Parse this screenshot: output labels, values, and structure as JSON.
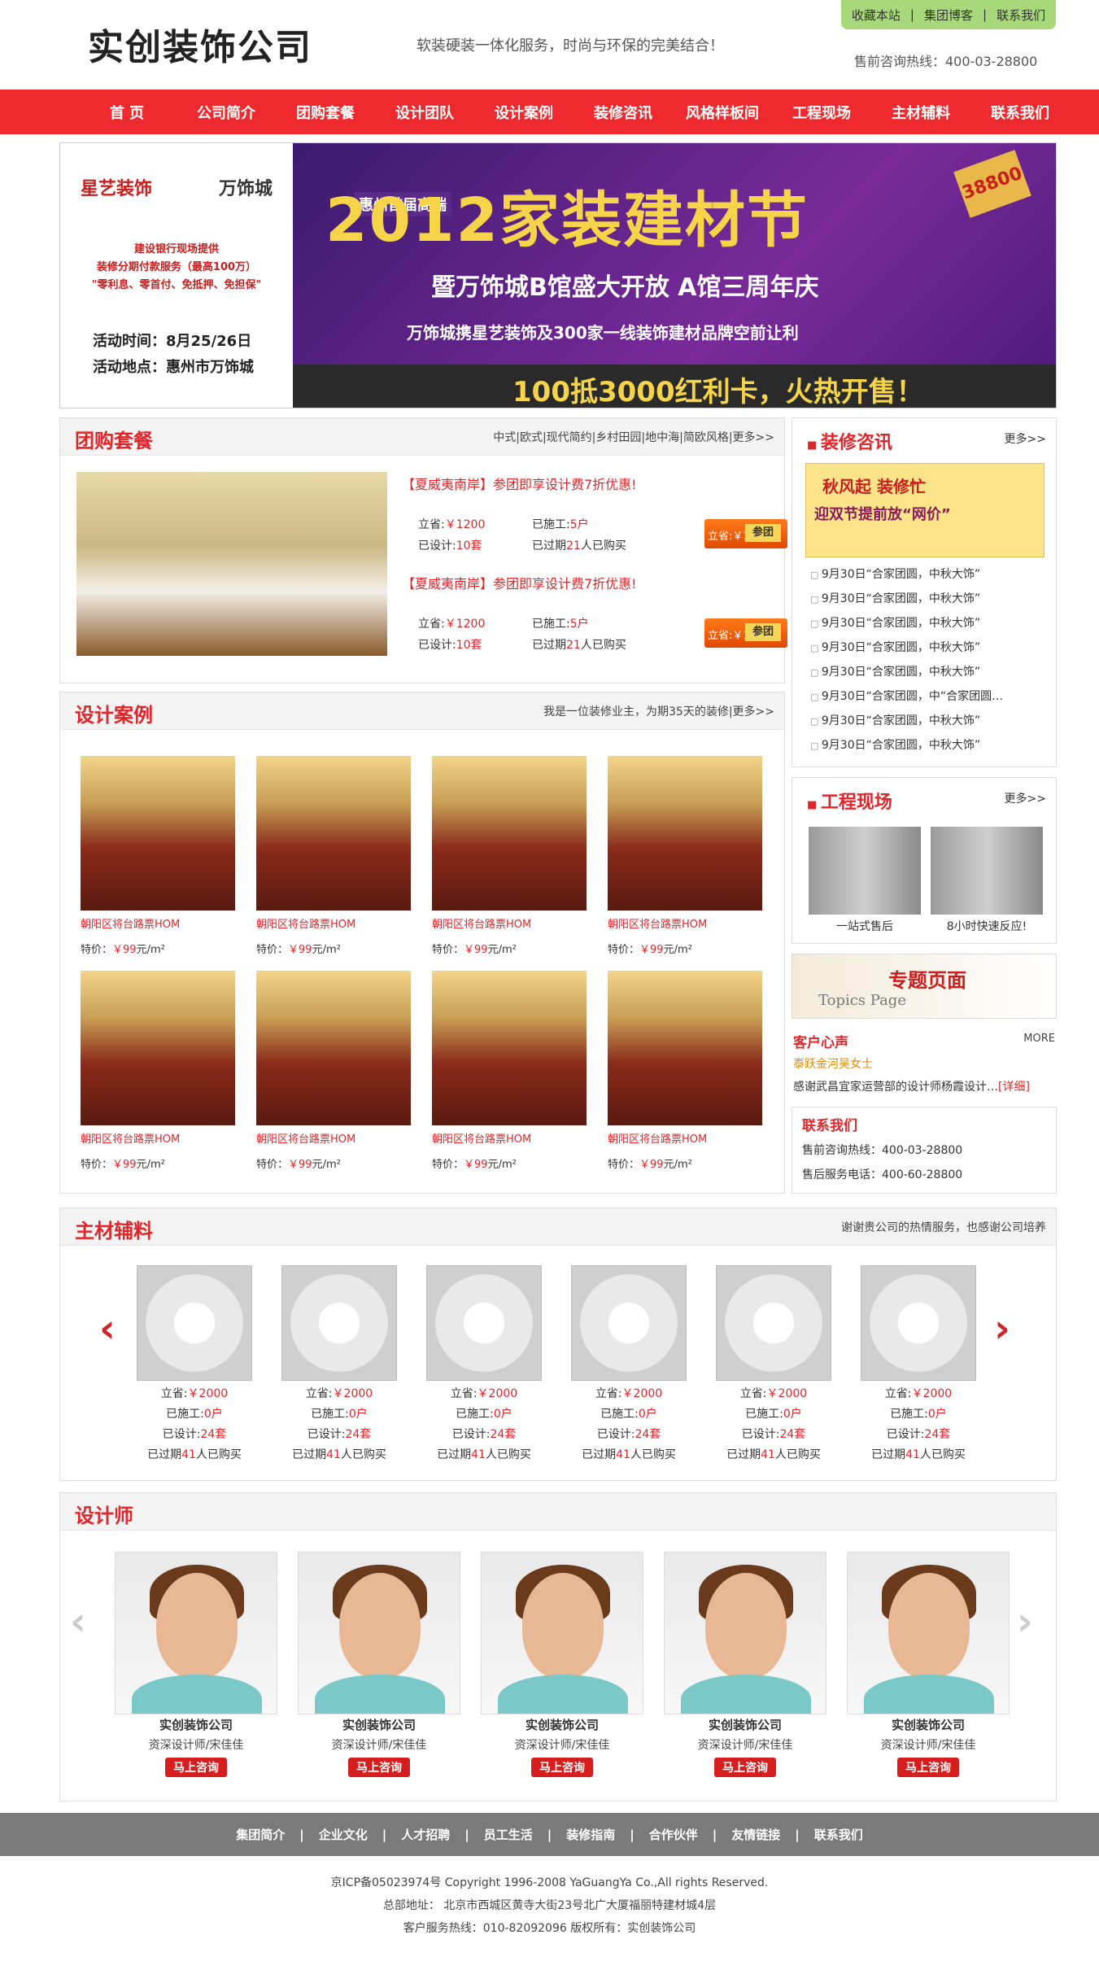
{
  "header": {
    "logo": "实创装饰公司",
    "slogan": "软装硬装一体化服务，时尚与环保的完美结合！",
    "toplinks": [
      "收藏本站",
      "集团博客",
      "联系我们"
    ],
    "hotline": "售前咨询热线：400-03-28800"
  },
  "nav": [
    "首 页",
    "公司简介",
    "团购套餐",
    "设计团队",
    "设计案例",
    "装修咨讯",
    "风格样板间",
    "工程现场",
    "主材辅料",
    "联系我们"
  ],
  "banner": {
    "brand": "星艺装饰",
    "brand2": "万饰城",
    "promo1": "建设银行现场提供",
    "promo2": "装修分期付款服务（最高100万）",
    "promo3": "\"零利息、零首付、免抵押、免担保\"",
    "date": "活动时间：8月25/26日",
    "place": "活动地点：惠州市万饰城",
    "headline": "2012家装建材节",
    "tag": "惠州首届高端",
    "sub": "暨万饰城B馆盛大开放 A馆三周年庆",
    "sub2": "万饰城携星艺装饰及300家一线装饰建材品牌空前让利",
    "bottom": "100抵3000红利卡，火热开售！",
    "corner": "38800"
  },
  "group": {
    "title": "团购套餐",
    "more": "中式|欧式|现代简约|乡村田园|地中海|简欧风格|更多>>",
    "items": [
      {
        "title": "【夏威夷南岸】参团即享设计费7折优惠!",
        "save_l": "立省:",
        "save": "￥1200",
        "work_l": "已施工:",
        "work": "5户",
        "design_l": "已设计:",
        "design": "10套",
        "past_a": "已过期",
        "past_n": "21",
        "past_b": "人已购买",
        "btn_price": "立省:￥1200",
        "btn": "参团"
      },
      {
        "title": "【夏威夷南岸】参团即享设计费7折优惠!",
        "save_l": "立省:",
        "save": "￥1200",
        "work_l": "已施工:",
        "work": "5户",
        "design_l": "已设计:",
        "design": "10套",
        "past_a": "已过期",
        "past_n": "21",
        "past_b": "人已购买",
        "btn_price": "立省:￥1200",
        "btn": "参团"
      }
    ]
  },
  "news": {
    "title": "装修咨讯",
    "more": "更多>>",
    "ad1": "秋风起 装修忙",
    "ad2": "迎双节提前放“网价”",
    "items": [
      "9月30日“合家团圆，中秋大饰”",
      "9月30日“合家团圆，中秋大饰”",
      "9月30日“合家团圆，中秋大饰”",
      "9月30日“合家团圆，中秋大饰”",
      "9月30日“合家团圆，中秋大饰”",
      "9月30日“合家团圆，中“合家团圆…",
      "9月30日“合家团圆，中秋大饰”",
      "9月30日“合家团圆，中秋大饰”"
    ]
  },
  "cases": {
    "title": "设计案例",
    "more": "我是一位装修业主，为期35天的装修|更多>>",
    "name": "朝阳区将台路票HOM",
    "price_l": "特价：",
    "price": "￥99",
    "price_u": "元/m²"
  },
  "site": {
    "title": "工程现场",
    "more": "更多>>",
    "items": [
      "一站式售后",
      "8小时快速反应!"
    ]
  },
  "topics": {
    "title": "专题页面",
    "en": "Topics Page"
  },
  "client": {
    "title": "客户心声",
    "more": "MORE",
    "name": "泰跃金河吴女士",
    "text": "感谢武昌宜家运营部的设计师杨霞设计…",
    "link": "[详细]"
  },
  "contact": {
    "title": "联系我们",
    "pre": "售前咨询热线：400-03-28800",
    "post": "售后服务电话：400-60-28800"
  },
  "materials": {
    "title": "主材辅料",
    "more": "谢谢贵公司的热情服务，也感谢公司培养",
    "save_l": "立省:",
    "save": "￥2000",
    "work_l": "已施工:",
    "work": "0户",
    "design_l": "已设计:",
    "design": "24套",
    "past_a": "已过期",
    "past_n": "41",
    "past_b": "人已购买"
  },
  "designers": {
    "title": "设计师",
    "company": "实创装饰公司",
    "role": "资深设计师/宋佳佳",
    "btn": "马上咨询"
  },
  "footer": {
    "links": [
      "集团简介",
      "企业文化",
      "人才招聘",
      "员工生活",
      "装修指南",
      "合作伙伴",
      "友情链接",
      "联系我们"
    ],
    "icp": "京ICP备05023974号 Copyright 1996-2008 YaGuangYa Co.,All rights Reserved.",
    "addr": "总部地址： 北京市西城区黄寺大街23号北广大厦福丽特建材城4层",
    "tel": "客户服务热线：010-82092096 版权所有：实创装饰公司"
  }
}
